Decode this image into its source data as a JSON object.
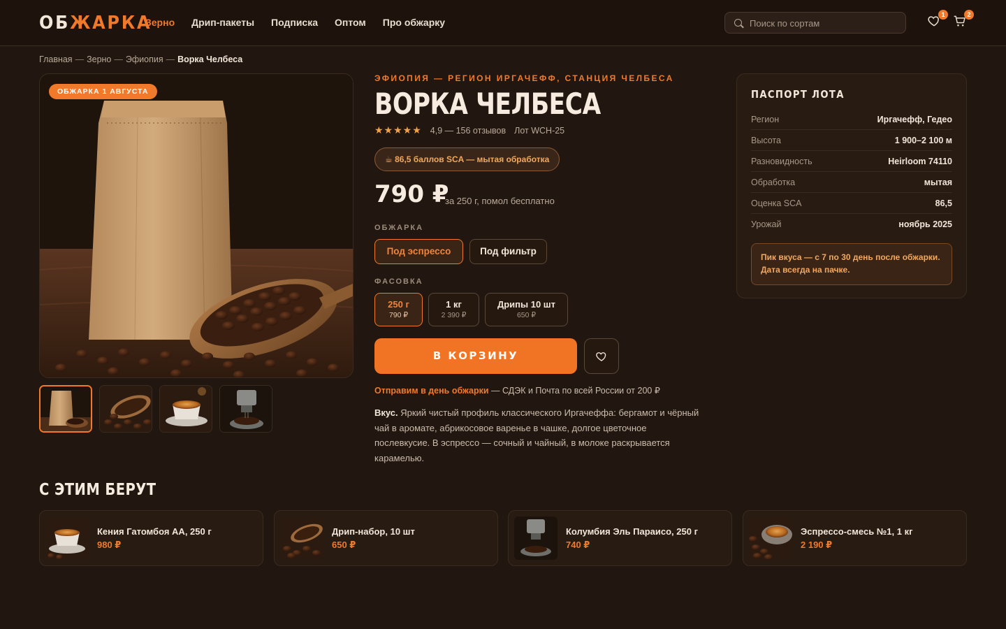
{
  "header": {
    "logo_main": "ОБ",
    "logo_accent": "ЖАРКА",
    "nav": [
      "Зерно",
      "Дрип-пакеты",
      "Подписка",
      "Оптом",
      "Про обжарку"
    ],
    "search_placeholder": "Поиск по сортам",
    "favorites_count": "1",
    "cart_count": "2"
  },
  "breadcrumb": {
    "items": [
      "Главная",
      "Зерно",
      "Эфиопия"
    ],
    "separator": "—",
    "current": "Ворка Челбеса"
  },
  "gallery": {
    "roast_tag": "ОБЖАРКА 1 АВГУСТА"
  },
  "product": {
    "origin": "ЭФИОПИЯ — РЕГИОН ИРГАЧЕФФ, СТАНЦИЯ ЧЕЛБЕСА",
    "title": "ВОРКА ЧЕЛБЕСА",
    "stars": "★★★★★",
    "rating_text": "4,9 — 156 отзывов",
    "lot": "Лот WCH-25",
    "sca_badge": "☕ 86,5 баллов SCA — мытая обработка",
    "price": "790 ₽",
    "price_note": "за 250 г, помол бесплатно",
    "roast_label": "ОБЖАРКА",
    "roast_options": [
      "Под эспрессо",
      "Под фильтр"
    ],
    "pack_label": "ФАСОВКА",
    "packs": [
      {
        "name": "250 г",
        "price": "790 ₽"
      },
      {
        "name": "1 кг",
        "price": "2 390 ₽"
      },
      {
        "name": "Дрипы 10 шт",
        "price": "650 ₽"
      }
    ],
    "cart_button": "В КОРЗИНУ",
    "shipping_highlight": "Отправим в день обжарки",
    "shipping_rest": " — СДЭК и Почта по всей России от 200 ₽",
    "taste_label": "Вкус.",
    "taste_text": " Яркий чистый профиль классического Иргачеффа: бергамот и чёрный чай в аромате, абрикосовое варенье в чашке, долгое цветочное послевкусие. В эспрессо — сочный и чайный, в молоке раскрывается карамелью."
  },
  "passport": {
    "title": "ПАСПОРТ ЛОТА",
    "rows": [
      {
        "k": "Регион",
        "v": "Иргачефф, Гедео"
      },
      {
        "k": "Высота",
        "v": "1 900–2 100 м"
      },
      {
        "k": "Разновидность",
        "v": "Heirloom 74110"
      },
      {
        "k": "Обработка",
        "v": "мытая"
      },
      {
        "k": "Оценка SCA",
        "v": "86,5"
      },
      {
        "k": "Урожай",
        "v": "ноябрь 2025"
      }
    ],
    "note": "Пик вкуса — с 7 по 30 день после обжарки. Дата всегда на пачке."
  },
  "related": {
    "title": "С ЭТИМ БЕРУТ",
    "items": [
      {
        "name": "Кения Гатомбоя АА, 250 г",
        "price": "980 ₽"
      },
      {
        "name": "Дрип-набор, 10 шт",
        "price": "650 ₽"
      },
      {
        "name": "Колумбия Эль Параисо, 250 г",
        "price": "740 ₽"
      },
      {
        "name": "Эспрессо-смесь №1, 1 кг",
        "price": "2 190 ₽"
      }
    ]
  },
  "colors": {
    "accent": "#f07a2a",
    "background": "#221710",
    "card": "#281b12"
  }
}
